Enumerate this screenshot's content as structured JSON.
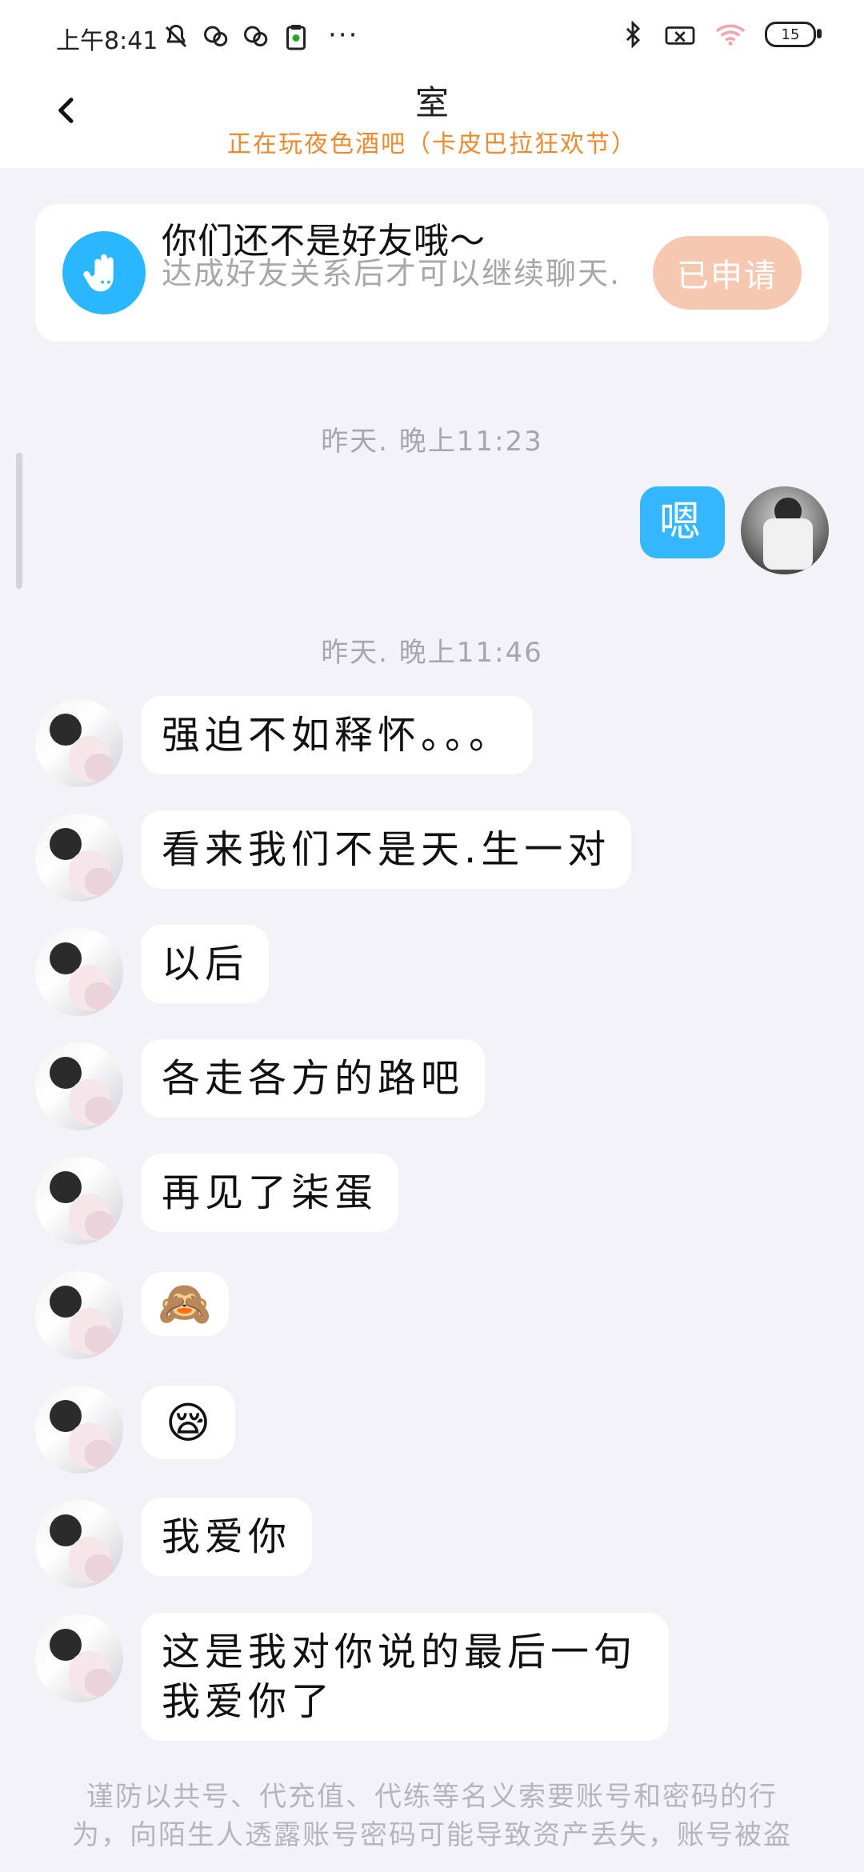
{
  "status_bar": {
    "time": "上午8:41",
    "more": "···",
    "battery": "15",
    "icons": [
      "mute-bell-icon",
      "wechat-icon",
      "wechat-icon",
      "clipboard-icon",
      "bluetooth-icon",
      "no-signal-icon",
      "wifi-icon",
      "battery-icon"
    ]
  },
  "header": {
    "title": "室",
    "subtitle": "正在玩夜色酒吧（卡皮巴拉狂欢节）"
  },
  "friend_card": {
    "title": "你们还不是好友哦〜",
    "subtitle": "达成好友关系后才可以继续聊天.",
    "button_label": "已申请",
    "icon_name": "hand-icon",
    "accent": "#2bb7ff"
  },
  "timestamps": {
    "t1": "昨天. 晚上11:23",
    "t2": "昨天. 晚上11:46"
  },
  "messages": [
    {
      "sender": "me",
      "text": "嗯"
    },
    {
      "sender": "other",
      "text": "强迫不如释怀。。。"
    },
    {
      "sender": "other",
      "text": "看来我们不是天.生一对"
    },
    {
      "sender": "other",
      "text": "以后"
    },
    {
      "sender": "other",
      "text": "各走各方的路吧"
    },
    {
      "sender": "other",
      "text": "再见了柒蛋"
    },
    {
      "sender": "other",
      "text": "🙈",
      "emoji_name": "monkey-emoji"
    },
    {
      "sender": "other",
      "text": "😪",
      "emoji_name": "sleepy-emoji"
    },
    {
      "sender": "other",
      "text": "我爱你"
    },
    {
      "sender": "other",
      "text": "这是我对你说的最后一句我爱你了"
    }
  ],
  "footer_notice": "谨防以共号、代充值、代练等名义索要账号和密码的行为，向陌生人透露账号密码可能导致资产丢失，账号被盗"
}
